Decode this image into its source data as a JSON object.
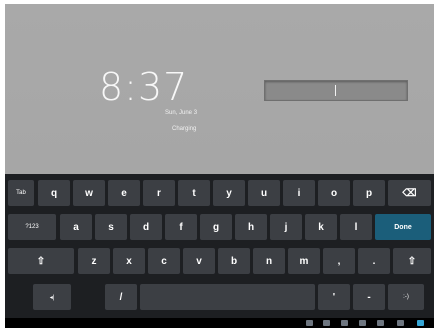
{
  "lock_screen": {
    "time": "8:37",
    "date": "Sun, June 3",
    "status": "Charging",
    "password_value": ""
  },
  "keyboard": {
    "row1": [
      {
        "label": "Tab",
        "name": "key-tab"
      },
      {
        "label": "q",
        "name": "key-q"
      },
      {
        "label": "w",
        "name": "key-w"
      },
      {
        "label": "e",
        "name": "key-e"
      },
      {
        "label": "r",
        "name": "key-r"
      },
      {
        "label": "t",
        "name": "key-t"
      },
      {
        "label": "y",
        "name": "key-y"
      },
      {
        "label": "u",
        "name": "key-u"
      },
      {
        "label": "i",
        "name": "key-i"
      },
      {
        "label": "o",
        "name": "key-o"
      },
      {
        "label": "p",
        "name": "key-p"
      },
      {
        "label": "⌫",
        "name": "key-delete"
      }
    ],
    "row2": [
      {
        "label": "?123",
        "name": "key-symbols"
      },
      {
        "label": "a",
        "name": "key-a"
      },
      {
        "label": "s",
        "name": "key-s"
      },
      {
        "label": "d",
        "name": "key-d"
      },
      {
        "label": "f",
        "name": "key-f"
      },
      {
        "label": "g",
        "name": "key-g"
      },
      {
        "label": "h",
        "name": "key-h"
      },
      {
        "label": "j",
        "name": "key-j"
      },
      {
        "label": "k",
        "name": "key-k"
      },
      {
        "label": "l",
        "name": "key-l"
      },
      {
        "label": "Done",
        "name": "key-done"
      }
    ],
    "row3": [
      {
        "label": "⇧",
        "name": "key-shift-left"
      },
      {
        "label": "z",
        "name": "key-z"
      },
      {
        "label": "x",
        "name": "key-x"
      },
      {
        "label": "c",
        "name": "key-c"
      },
      {
        "label": "v",
        "name": "key-v"
      },
      {
        "label": "b",
        "name": "key-b"
      },
      {
        "label": "n",
        "name": "key-n"
      },
      {
        "label": "m",
        "name": "key-m"
      },
      {
        "label": ",",
        "name": "key-comma"
      },
      {
        "label": ".",
        "name": "key-period"
      },
      {
        "label": "⇧",
        "name": "key-shift-right"
      }
    ],
    "row4": [
      {
        "label": "◂|",
        "name": "key-input-method"
      },
      {
        "label": "/",
        "name": "key-slash"
      },
      {
        "label": "",
        "name": "key-space"
      },
      {
        "label": "'",
        "name": "key-apostrophe"
      },
      {
        "label": "-",
        "name": "key-dash"
      },
      {
        "label": ":-)",
        "name": "key-smiley"
      }
    ]
  }
}
